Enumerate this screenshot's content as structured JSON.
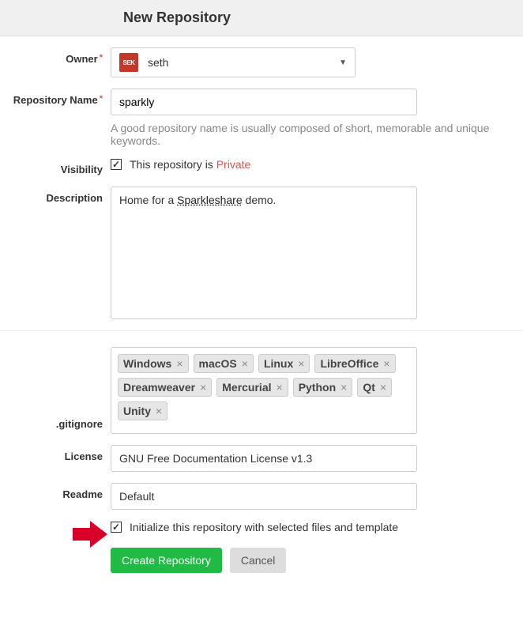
{
  "header": {
    "title": "New Repository"
  },
  "owner": {
    "label": "Owner",
    "avatar_text": "SEK",
    "name": "seth"
  },
  "repo_name": {
    "label": "Repository Name",
    "value": "sparkly",
    "hint": "A good repository name is usually composed of short, memorable and unique keywords."
  },
  "visibility": {
    "label": "Visibility",
    "prefix": "This repository is ",
    "state": "Private",
    "checked": true
  },
  "description": {
    "label": "Description",
    "prefix": "Home for a ",
    "link": "Sparkleshare",
    "suffix": " demo."
  },
  "gitignore": {
    "label": ".gitignore",
    "tags": [
      "Windows",
      "macOS",
      "Linux",
      "LibreOffice",
      "Dreamweaver",
      "Mercurial",
      "Python",
      "Qt",
      "Unity"
    ]
  },
  "license": {
    "label": "License",
    "value": "GNU Free Documentation License v1.3"
  },
  "readme": {
    "label": "Readme",
    "value": "Default"
  },
  "init": {
    "checked": true,
    "text": "Initialize this repository with selected files and template"
  },
  "buttons": {
    "create": "Create Repository",
    "cancel": "Cancel"
  }
}
